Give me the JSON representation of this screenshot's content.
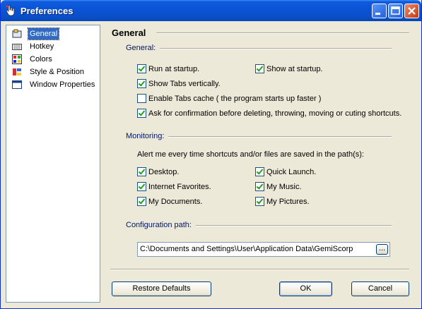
{
  "window": {
    "title": "Preferences",
    "controls": [
      "minimize",
      "maximize",
      "close"
    ]
  },
  "sidebar": {
    "items": [
      {
        "label": "General",
        "icon": "general-icon",
        "selected": true
      },
      {
        "label": "Hotkey",
        "icon": "keyboard-icon",
        "selected": false
      },
      {
        "label": "Colors",
        "icon": "palette-icon",
        "selected": false
      },
      {
        "label": "Style & Position",
        "icon": "style-icon",
        "selected": false
      },
      {
        "label": "Window Properties",
        "icon": "window-icon",
        "selected": false
      }
    ]
  },
  "main": {
    "heading": "General",
    "general": {
      "label": "General:",
      "run_at_startup": {
        "label": "Run at startup.",
        "checked": true
      },
      "show_at_startup": {
        "label": "Show at startup.",
        "checked": true
      },
      "show_tabs_vertically": {
        "label": "Show Tabs vertically.",
        "checked": true
      },
      "enable_tabs_cache": {
        "label": "Enable Tabs cache  ( the program starts up faster )",
        "checked": false
      },
      "ask_confirmation": {
        "label": "Ask for confirmation before deleting, throwing, moving or cuting shortcuts.",
        "checked": true
      }
    },
    "monitoring": {
      "label": "Monitoring:",
      "description": "Alert me every time shortcuts and/or files are saved in the path(s):",
      "desktop": {
        "label": "Desktop.",
        "checked": true
      },
      "quick_launch": {
        "label": "Quick Launch.",
        "checked": true
      },
      "internet_favorites": {
        "label": "Internet Favorites.",
        "checked": true
      },
      "my_music": {
        "label": "My Music.",
        "checked": true
      },
      "my_documents": {
        "label": "My Documents.",
        "checked": true
      },
      "my_pictures": {
        "label": "My Pictures.",
        "checked": true
      }
    },
    "config": {
      "label": "Configuration path:",
      "path": "C:\\Documents and Settings\\User\\Application Data\\GemiScorp",
      "browse_label": "..."
    }
  },
  "buttons": {
    "restore_defaults": "Restore Defaults",
    "ok": "OK",
    "cancel": "Cancel"
  },
  "colors": {
    "titlebar": "#0a54d6",
    "selection": "#316ac5",
    "group_label": "#00156e"
  }
}
